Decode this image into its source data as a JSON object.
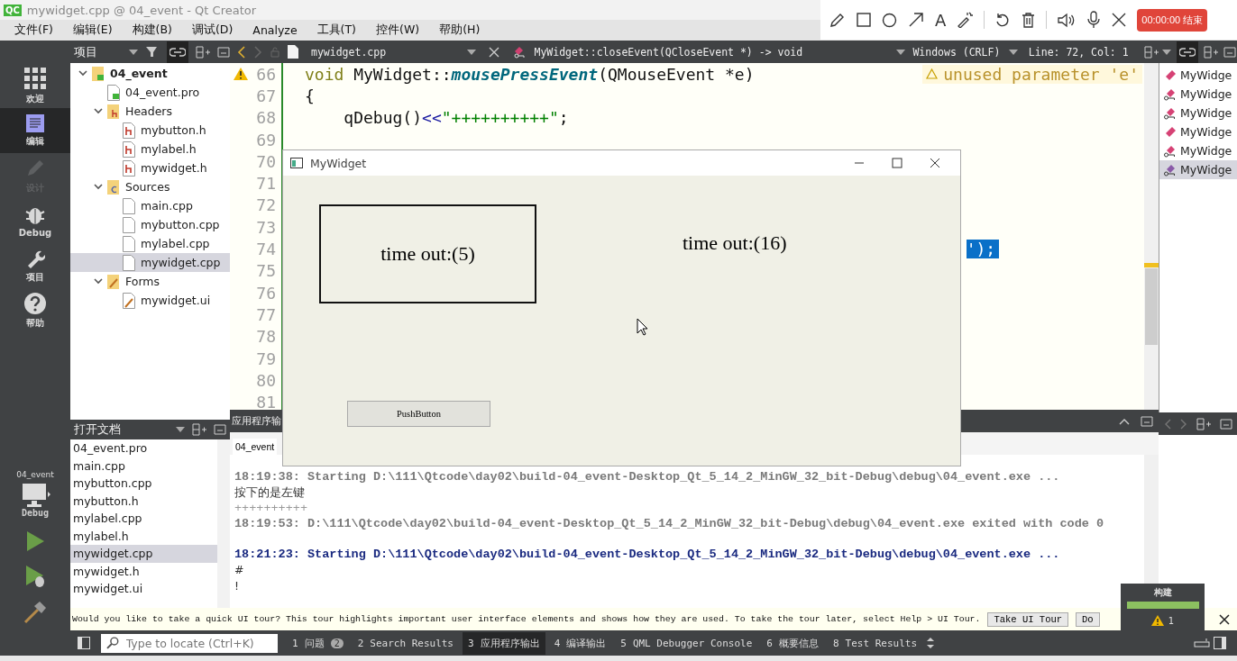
{
  "window": {
    "logo": "QC",
    "title": "mywidget.cpp @ 04_event - Qt Creator"
  },
  "recorder": {
    "text_tool": "A",
    "timer": "00:00:00 结束"
  },
  "menu": [
    "文件(F)",
    "编辑(E)",
    "构建(B)",
    "调试(D)",
    "Analyze",
    "工具(T)",
    "控件(W)",
    "帮助(H)"
  ],
  "modes": [
    {
      "label": "欢迎",
      "kind": "welcome",
      "selected": false,
      "disabled": false
    },
    {
      "label": "编辑",
      "kind": "edit",
      "selected": true,
      "disabled": false
    },
    {
      "label": "设计",
      "kind": "design",
      "selected": false,
      "disabled": true
    },
    {
      "label": "Debug",
      "kind": "debug",
      "selected": false,
      "disabled": false
    },
    {
      "label": "项目",
      "kind": "projects",
      "selected": false,
      "disabled": false
    },
    {
      "label": "帮助",
      "kind": "help",
      "selected": false,
      "disabled": false
    }
  ],
  "kit": {
    "project": "04_event",
    "config": "Debug"
  },
  "projects": {
    "title": "项目",
    "tree": [
      {
        "label": "04_event",
        "kind": "project",
        "expanded": true,
        "selected": false,
        "children": [
          {
            "label": "04_event.pro",
            "kind": "pro",
            "selected": false
          },
          {
            "label": "Headers",
            "kind": "folder_h",
            "expanded": true,
            "selected": false,
            "children": [
              {
                "label": "mybutton.h",
                "kind": "header",
                "selected": false
              },
              {
                "label": "mylabel.h",
                "kind": "header",
                "selected": false
              },
              {
                "label": "mywidget.h",
                "kind": "header",
                "selected": false
              }
            ]
          },
          {
            "label": "Sources",
            "kind": "folder_src",
            "expanded": true,
            "selected": false,
            "children": [
              {
                "label": "main.cpp",
                "kind": "source",
                "selected": false
              },
              {
                "label": "mybutton.cpp",
                "kind": "source",
                "selected": false
              },
              {
                "label": "mylabel.cpp",
                "kind": "source",
                "selected": false
              },
              {
                "label": "mywidget.cpp",
                "kind": "source",
                "selected": true
              }
            ]
          },
          {
            "label": "Forms",
            "kind": "folder_forms",
            "expanded": true,
            "selected": false,
            "children": [
              {
                "label": "mywidget.ui",
                "kind": "form",
                "selected": false
              }
            ]
          }
        ]
      }
    ]
  },
  "open_documents": {
    "title": "打开文档",
    "items": [
      {
        "label": "04_event.pro",
        "selected": false
      },
      {
        "label": "main.cpp",
        "selected": false
      },
      {
        "label": "mybutton.cpp",
        "selected": false
      },
      {
        "label": "mybutton.h",
        "selected": false
      },
      {
        "label": "mylabel.cpp",
        "selected": false
      },
      {
        "label": "mylabel.h",
        "selected": false
      },
      {
        "label": "mywidget.cpp",
        "selected": true
      },
      {
        "label": "mywidget.h",
        "selected": false
      },
      {
        "label": "mywidget.ui",
        "selected": false
      }
    ]
  },
  "editor": {
    "file": "mywidget.cpp",
    "symbol": "MyWidget::closeEvent(QCloseEvent *) -> void",
    "encoding": "Windows (CRLF)",
    "position": "Line: 72, Col: 1",
    "lines": [
      {
        "number": "66",
        "warning": true,
        "note": "unused parameter 'e'",
        "tokens": [
          {
            "text": "void",
            "kind": "keyword"
          },
          {
            "text": " MyWidget::",
            "kind": "plain"
          },
          {
            "text": "mousePressEvent",
            "kind": "function"
          },
          {
            "text": "(QMouseEvent *e)",
            "kind": "plain"
          }
        ]
      },
      {
        "number": "67",
        "warning": false,
        "tokens": [
          {
            "text": "{",
            "kind": "plain"
          }
        ]
      },
      {
        "number": "68",
        "warning": false,
        "tokens": [
          {
            "text": "    qDebug()",
            "kind": "plain"
          },
          {
            "text": "<<",
            "kind": "operator"
          },
          {
            "text": "\"++++++++++\"",
            "kind": "string"
          },
          {
            "text": ";",
            "kind": "plain"
          }
        ]
      },
      {
        "number": "69",
        "warning": false
      },
      {
        "number": "70",
        "warning": false
      },
      {
        "number": "71",
        "warning": false
      },
      {
        "number": "72",
        "warning": false
      },
      {
        "number": "73",
        "warning": false
      },
      {
        "number": "74",
        "warning": false,
        "selected_tail": "');"
      },
      {
        "number": "75",
        "warning": false
      },
      {
        "number": "76",
        "warning": false
      },
      {
        "number": "77",
        "warning": false
      },
      {
        "number": "78",
        "warning": false
      },
      {
        "number": "79",
        "warning": false
      },
      {
        "number": "80",
        "warning": false
      },
      {
        "number": "81",
        "warning": false
      }
    ]
  },
  "outline": [
    {
      "label": "MyWidge",
      "kind": "method",
      "selected": false
    },
    {
      "label": "MyWidge",
      "kind": "keyed",
      "selected": false
    },
    {
      "label": "MyWidge",
      "kind": "keyed",
      "selected": false
    },
    {
      "label": "MyWidge",
      "kind": "method",
      "selected": false
    },
    {
      "label": "MyWidge",
      "kind": "keyed",
      "selected": false
    },
    {
      "label": "MyWidge",
      "kind": "keyed",
      "selected": true
    }
  ],
  "output": {
    "title": "应用程序输",
    "tab": "04_event",
    "lines": [
      {
        "text": "18:19:38: Starting D:\\111\\Qtcode\\day02\\build-04_event-Desktop_Qt_5_14_2_MinGW_32_bit-Debug\\debug\\04_event.exe ...",
        "kind": "system"
      },
      {
        "text": "按下的是左键",
        "kind": "stdout"
      },
      {
        "text": "++++++++++",
        "kind": "faded"
      },
      {
        "text": "18:19:53: D:\\111\\Qtcode\\day02\\build-04_event-Desktop_Qt_5_14_2_MinGW_32_bit-Debug\\debug\\04_event.exe exited with code 0",
        "kind": "system"
      },
      {
        "text": "18:21:23: Starting D:\\111\\Qtcode\\day02\\build-04_event-Desktop_Qt_5_14_2_MinGW_32_bit-Debug\\debug\\04_event.exe ...",
        "kind": "start"
      },
      {
        "text": "#",
        "kind": "stdout"
      },
      {
        "text": "!",
        "kind": "stdout"
      }
    ]
  },
  "app_window": {
    "title": "MyWidget",
    "boxed_label": "time out:(5)",
    "label": "time out:(16)",
    "button": "PushButton"
  },
  "tour": {
    "text": "Would you like to take a quick UI tour? This tour highlights important user interface elements and shows how they are used. To take the tour later, select Help > UI Tour.",
    "buttons": [
      "Take UI Tour",
      "Do"
    ]
  },
  "status": {
    "locate_placeholder": "Type to locate (Ctrl+K)",
    "tabs": [
      {
        "number": "1",
        "label": "问题",
        "badge": "2",
        "selected": false
      },
      {
        "number": "2",
        "label": "Search Results",
        "selected": false
      },
      {
        "number": "3",
        "label": "应用程序输出",
        "selected": true
      },
      {
        "number": "4",
        "label": "编译输出",
        "selected": false
      },
      {
        "number": "5",
        "label": "QML Debugger Console",
        "selected": false
      },
      {
        "number": "6",
        "label": "概要信息",
        "selected": false
      },
      {
        "number": "8",
        "label": "Test Results",
        "selected": false
      }
    ]
  },
  "build": {
    "title": "构建",
    "level": 1,
    "warnings": "1"
  }
}
